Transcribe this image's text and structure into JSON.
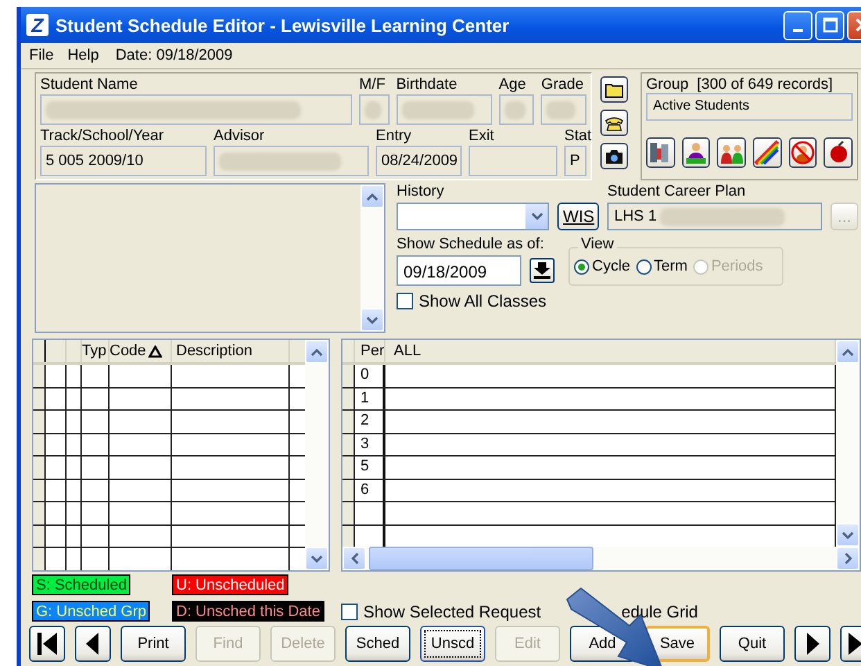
{
  "window": {
    "title": "Student Schedule Editor - Lewisville Learning Center",
    "logo": "Z"
  },
  "menu": [
    {
      "label": "File"
    },
    {
      "label": "Help"
    }
  ],
  "date_label": "Date: 09/18/2009",
  "student_row1": [
    {
      "label": "Student Name",
      "redacted": true
    },
    {
      "label": "M/F",
      "redacted": true
    },
    {
      "label": "Birthdate",
      "redacted": true
    },
    {
      "label": "Age",
      "redacted": true
    },
    {
      "label": "Grade",
      "redacted": true
    }
  ],
  "student_row2": [
    {
      "label": "Track/School/Year",
      "value": "5 005 2009/10"
    },
    {
      "label": "Advisor",
      "redacted": true
    },
    {
      "label": "Entry",
      "value": "08/24/2009"
    },
    {
      "label": "Exit"
    },
    {
      "label": "Stat",
      "value": "P"
    }
  ],
  "group": {
    "label": "Group  [300 of 649 records]",
    "value": "Active Students"
  },
  "history": {
    "label": "History"
  },
  "wis_button": "WIS",
  "career_plan": {
    "label": "Student Career Plan",
    "value": "LHS 1",
    "redacted": true,
    "button": "..."
  },
  "show_schedule": {
    "label": "Show Schedule as of:",
    "value": "09/18/2009"
  },
  "view": {
    "label": "View",
    "options": [
      {
        "label": "Cycle",
        "selected": true,
        "disabled": false
      },
      {
        "label": "Term",
        "selected": false,
        "disabled": false
      },
      {
        "label": "Periods",
        "selected": false,
        "disabled": true
      }
    ]
  },
  "show_all_classes": {
    "label": "Show All Classes",
    "checked": false
  },
  "requests_grid": {
    "columns": [
      "Typ",
      "Code",
      "Description"
    ]
  },
  "schedule_grid": {
    "columns": [
      "Per",
      "ALL"
    ],
    "rows": [
      "0",
      "1",
      "2",
      "3",
      "5",
      "6"
    ]
  },
  "legend": [
    {
      "label": "S: Scheduled",
      "color": "#00ee44"
    },
    {
      "label": "U: Unscheduled",
      "color": "#ff0000"
    },
    {
      "label": "G: Unsched Grp",
      "color": "#0a84ff"
    },
    {
      "label": "D: Unsched this Date",
      "color": "#000000"
    }
  ],
  "show_selected": {
    "label_parts": [
      "Show Selected Request",
      "edule Grid"
    ],
    "checked": false
  },
  "buttons": [
    {
      "kind": "first",
      "disabled": false
    },
    {
      "kind": "prev",
      "disabled": false
    },
    {
      "kind": "text",
      "label": "Print",
      "disabled": false,
      "default": false,
      "focused": false
    },
    {
      "kind": "text",
      "label": "Find",
      "disabled": true,
      "default": false,
      "focused": false
    },
    {
      "kind": "text",
      "label": "Delete",
      "disabled": true,
      "default": false,
      "focused": false
    },
    {
      "kind": "text",
      "label": "Sched",
      "disabled": false,
      "default": false,
      "focused": false
    },
    {
      "kind": "text",
      "label": "Unscd",
      "disabled": false,
      "default": false,
      "focused": true
    },
    {
      "kind": "text",
      "label": "Edit",
      "disabled": true,
      "default": false,
      "focused": false
    },
    {
      "kind": "text",
      "label": "Add",
      "disabled": false,
      "default": false,
      "focused": false
    },
    {
      "kind": "text",
      "label": "Save",
      "disabled": false,
      "default": true,
      "focused": false
    },
    {
      "kind": "text",
      "label": "Quit",
      "disabled": false,
      "default": false,
      "focused": false
    },
    {
      "kind": "next",
      "disabled": false
    },
    {
      "kind": "last",
      "disabled": false
    }
  ]
}
